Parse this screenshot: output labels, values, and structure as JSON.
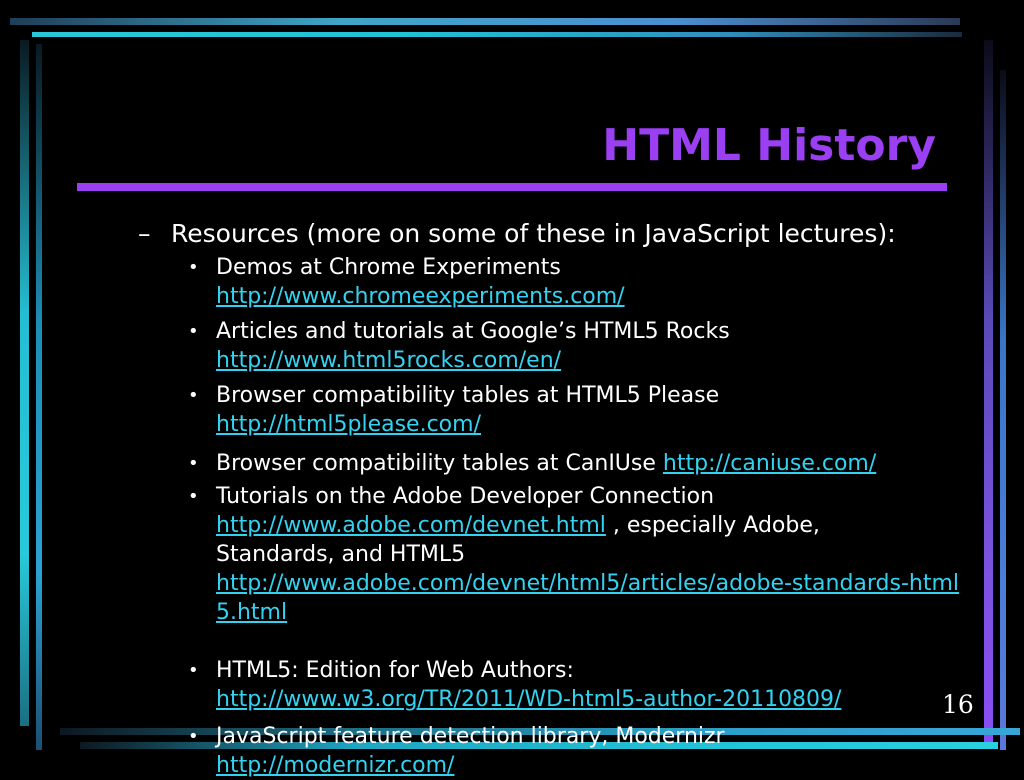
{
  "slide": {
    "title": "HTML History",
    "page_number": "16",
    "colors": {
      "title": "#9b3ff2",
      "link": "#33d2f0",
      "background": "#000000"
    }
  },
  "content": {
    "level1_marker": "–",
    "level1_text": "Resources (more on some of these in JavaScript lectures):",
    "bullets": [
      {
        "text": "Demos at Chrome Experiments",
        "link": "http://www.chromeexperiments.com/"
      },
      {
        "text": "Articles and tutorials at Google’s HTML5 Rocks",
        "link": "http://www.html5rocks.com/en/"
      },
      {
        "text": "Browser compatibility tables at HTML5 Please",
        "link": "http://html5please.com/"
      },
      {
        "text": "Browser compatibility tables at CanIUse",
        "link": "http://caniuse.com/"
      },
      {
        "text": "Tutorials on the Adobe Developer Connection",
        "link": "http://www.adobe.com/devnet.html",
        "after_link": ", especially Adobe, Standards, and HTML5",
        "link2": "http://www.adobe.com/devnet/html5/articles/adobe-standards-html5.html"
      },
      {
        "text": "HTML5: Edition for Web Authors:",
        "link": "http://www.w3.org/TR/2011/WD-html5-author-20110809/"
      },
      {
        "text": "JavaScript feature detection library, Modernizr",
        "link": "http://modernizr.com/"
      }
    ]
  }
}
